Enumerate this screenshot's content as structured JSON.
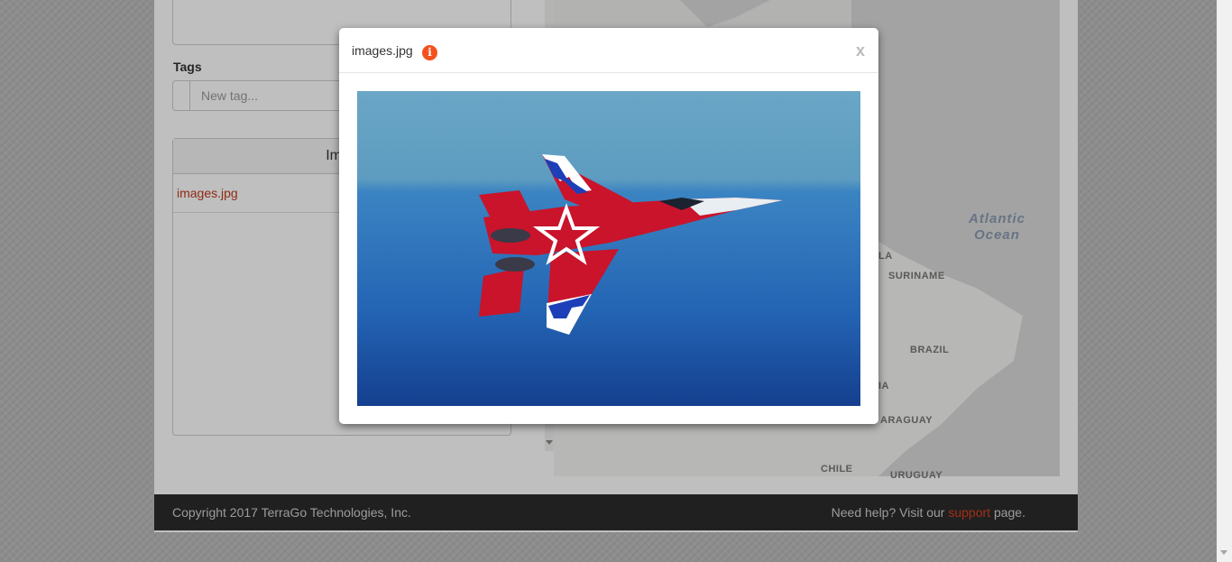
{
  "form": {
    "tags_label": "Tags",
    "tag_placeholder": "New tag...",
    "images_header": "Imag",
    "images": [
      "images.jpg"
    ]
  },
  "map": {
    "ocean_label_1": "Atlantic",
    "ocean_label_2": "Ocean",
    "country_labels": [
      "LA",
      "SURINAME",
      "BRAZIL",
      "IA",
      "ARAGUAY",
      "CHILE",
      "URUGUAY"
    ]
  },
  "footer": {
    "copyright": "Copyright 2017 TerraGo Technologies, Inc.",
    "help_prefix": "Need help? Visit our",
    "support_link": "support",
    "help_suffix": "page."
  },
  "modal": {
    "title": "images.jpg",
    "info_icon": "info-icon",
    "close_label": "x",
    "image_description_icon": "fighter-jet-photo"
  },
  "colors": {
    "accent": "#d9401c",
    "info": "#f4511e",
    "footer_bg": "#2b2b2b"
  }
}
